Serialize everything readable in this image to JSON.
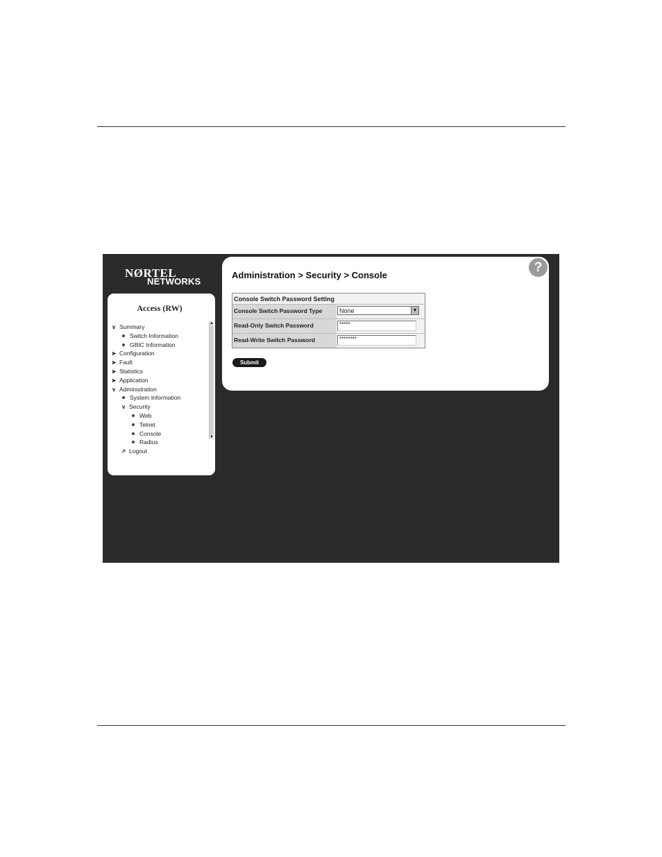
{
  "logo": {
    "line1": "NØRTEL",
    "line2": "NETWORKS"
  },
  "nav": {
    "title": "Access (RW)",
    "items": [
      {
        "icon": "chevron-down-icon",
        "glyph": "∨",
        "label": "Summary"
      },
      {
        "icon": "bullet-icon",
        "label": "Switch Information"
      },
      {
        "icon": "bullet-icon",
        "label": "GBIC Information"
      },
      {
        "icon": "chevron-right-icon",
        "glyph": "➤",
        "label": "Configuration"
      },
      {
        "icon": "chevron-right-icon",
        "glyph": "➤",
        "label": "Fault"
      },
      {
        "icon": "chevron-right-icon",
        "glyph": "➤",
        "label": "Statistics"
      },
      {
        "icon": "chevron-right-icon",
        "glyph": "➤",
        "label": "Application"
      },
      {
        "icon": "chevron-down-icon",
        "glyph": "∨",
        "label": "Administration"
      },
      {
        "icon": "bullet-icon",
        "label": "System Information"
      },
      {
        "icon": "chevron-down-icon",
        "glyph": "∨",
        "label": "Security"
      },
      {
        "icon": "bullet-icon",
        "label": "Web"
      },
      {
        "icon": "bullet-icon",
        "label": "Telnet"
      },
      {
        "icon": "bullet-icon",
        "label": "Console"
      },
      {
        "icon": "bullet-icon",
        "label": "Radius"
      },
      {
        "icon": "logout-icon",
        "glyph": "↗",
        "label": "Logout"
      }
    ]
  },
  "header": {
    "breadcrumb": "Administration > Security > Console",
    "help_icon": "question-mark-icon",
    "help_glyph": "?"
  },
  "form": {
    "caption": "Console Switch Password Setting",
    "rows": [
      {
        "label": "Console Switch Password Type",
        "value": "None"
      },
      {
        "label": "Read-Only Switch Password",
        "value": "*****"
      },
      {
        "label": "Read-Write Switch Password",
        "value": "********"
      }
    ],
    "select_arrow": "▼",
    "submit_label": "Submit"
  },
  "colors": {
    "background": "#2b2b2b",
    "panel": "#ffffff",
    "label_bg": "#d8d8d8"
  }
}
